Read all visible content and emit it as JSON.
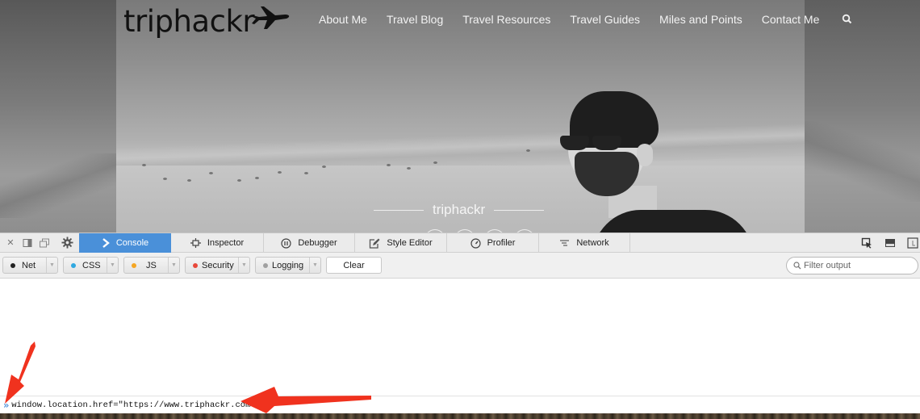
{
  "site": {
    "logo_text": "triphackr",
    "nav": [
      {
        "label": "About Me"
      },
      {
        "label": "Travel Blog"
      },
      {
        "label": "Travel Resources"
      },
      {
        "label": "Travel Guides"
      },
      {
        "label": "Miles and Points"
      },
      {
        "label": "Contact Me"
      }
    ],
    "search_icon": "search-icon",
    "hero_caption": "triphackr"
  },
  "devtools": {
    "toolbar_icons": [
      "close-icon",
      "dock-side-icon",
      "undock-window-icon",
      "settings-gear-icon"
    ],
    "tabs": [
      {
        "label": "Console",
        "icon": "console-chevron-icon",
        "active": true
      },
      {
        "label": "Inspector",
        "icon": "inspector-frame-icon",
        "active": false
      },
      {
        "label": "Debugger",
        "icon": "debugger-pause-icon",
        "active": false
      },
      {
        "label": "Style Editor",
        "icon": "style-editor-pencil-icon",
        "active": false
      },
      {
        "label": "Profiler",
        "icon": "profiler-gauge-icon",
        "active": false
      },
      {
        "label": "Network",
        "icon": "network-waterfall-icon",
        "active": false
      }
    ],
    "right_icons": [
      "pick-element-icon",
      "split-console-icon",
      "responsive-mode-icon"
    ],
    "filters": [
      {
        "label": "Net",
        "color": "#222222"
      },
      {
        "label": "CSS",
        "color": "#2fa8e0"
      },
      {
        "label": "JS",
        "color": "#f5a623"
      },
      {
        "label": "Security",
        "color": "#e8483a"
      },
      {
        "label": "Logging",
        "color": "#a0a0a0"
      }
    ],
    "clear_label": "Clear",
    "filter_placeholder": "Filter output",
    "command_prompt": "»",
    "command_text": "window.location.href=\"https://www.triphackr.com"
  },
  "colors": {
    "accent": "#4a90d9",
    "annotation_arrow": "#f0321e"
  }
}
